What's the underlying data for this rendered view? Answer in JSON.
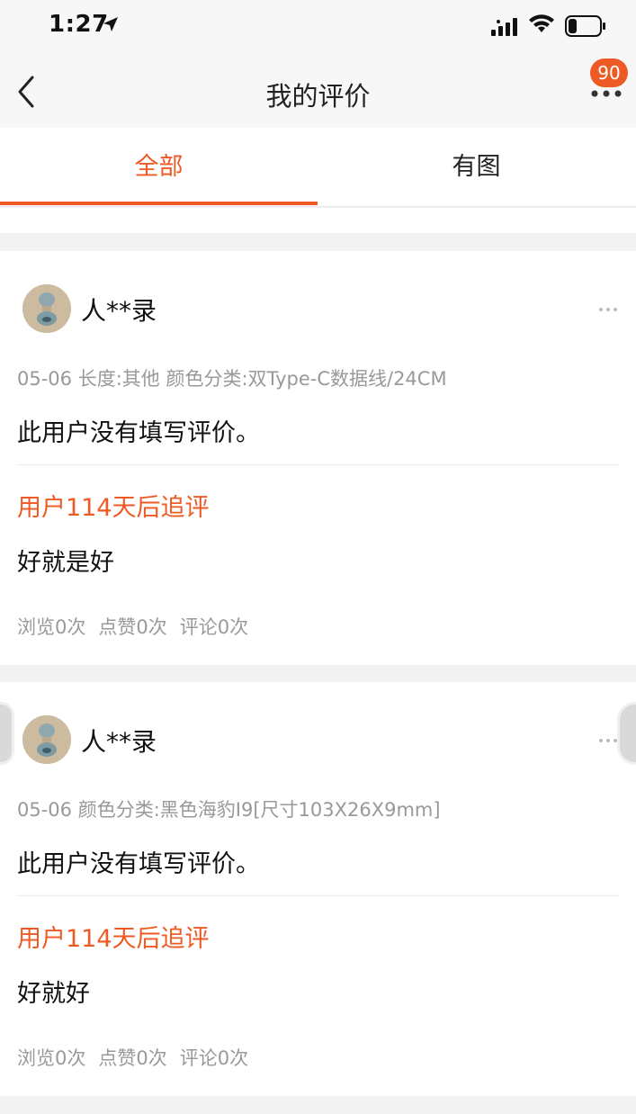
{
  "status_bar": {
    "time": "1:27",
    "icons": [
      "location-arrow-icon",
      "signal-icon",
      "wifi-icon",
      "battery-icon"
    ]
  },
  "nav": {
    "title": "我的评价",
    "back_icon": "back-chevron-icon",
    "more_icon": "more-dots-icon",
    "badge": "90"
  },
  "tabs": [
    {
      "label": "全部",
      "active": true
    },
    {
      "label": "有图",
      "active": false
    }
  ],
  "colors": {
    "accent": "#ee5a24",
    "muted": "#999999",
    "background": "#f2f2f2"
  },
  "reviews": [
    {
      "username": "人**录",
      "meta": "05-06 长度:其他 颜色分类:双Type-C数据线/24CM",
      "content": "此用户没有填写评价。",
      "followup_title": "用户114天后追评",
      "followup_text": "好就是好",
      "stats": [
        "浏览0次",
        "点赞0次",
        "评论0次"
      ]
    },
    {
      "username": "人**录",
      "meta": "05-06 颜色分类:黑色海豹I9[尺寸103X26X9mm]",
      "content": "此用户没有填写评价。",
      "followup_title": "用户114天后追评",
      "followup_text": "好就好",
      "stats": [
        "浏览0次",
        "点赞0次",
        "评论0次"
      ]
    }
  ]
}
